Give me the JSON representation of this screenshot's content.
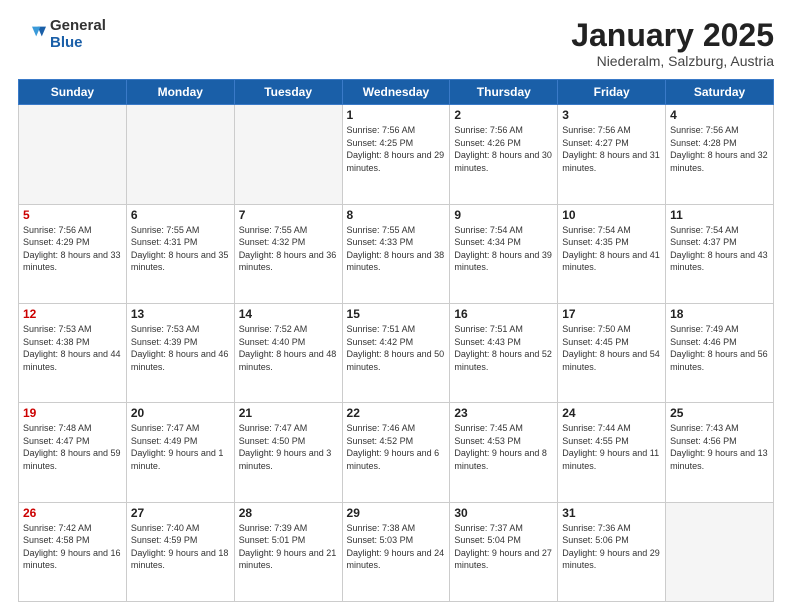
{
  "logo": {
    "general": "General",
    "blue": "Blue"
  },
  "header": {
    "month": "January 2025",
    "location": "Niederalm, Salzburg, Austria"
  },
  "weekdays": [
    "Sunday",
    "Monday",
    "Tuesday",
    "Wednesday",
    "Thursday",
    "Friday",
    "Saturday"
  ],
  "weeks": [
    [
      {
        "day": "",
        "info": ""
      },
      {
        "day": "",
        "info": ""
      },
      {
        "day": "",
        "info": ""
      },
      {
        "day": "1",
        "info": "Sunrise: 7:56 AM\nSunset: 4:25 PM\nDaylight: 8 hours\nand 29 minutes."
      },
      {
        "day": "2",
        "info": "Sunrise: 7:56 AM\nSunset: 4:26 PM\nDaylight: 8 hours\nand 30 minutes."
      },
      {
        "day": "3",
        "info": "Sunrise: 7:56 AM\nSunset: 4:27 PM\nDaylight: 8 hours\nand 31 minutes."
      },
      {
        "day": "4",
        "info": "Sunrise: 7:56 AM\nSunset: 4:28 PM\nDaylight: 8 hours\nand 32 minutes."
      }
    ],
    [
      {
        "day": "5",
        "info": "Sunrise: 7:56 AM\nSunset: 4:29 PM\nDaylight: 8 hours\nand 33 minutes."
      },
      {
        "day": "6",
        "info": "Sunrise: 7:55 AM\nSunset: 4:31 PM\nDaylight: 8 hours\nand 35 minutes."
      },
      {
        "day": "7",
        "info": "Sunrise: 7:55 AM\nSunset: 4:32 PM\nDaylight: 8 hours\nand 36 minutes."
      },
      {
        "day": "8",
        "info": "Sunrise: 7:55 AM\nSunset: 4:33 PM\nDaylight: 8 hours\nand 38 minutes."
      },
      {
        "day": "9",
        "info": "Sunrise: 7:54 AM\nSunset: 4:34 PM\nDaylight: 8 hours\nand 39 minutes."
      },
      {
        "day": "10",
        "info": "Sunrise: 7:54 AM\nSunset: 4:35 PM\nDaylight: 8 hours\nand 41 minutes."
      },
      {
        "day": "11",
        "info": "Sunrise: 7:54 AM\nSunset: 4:37 PM\nDaylight: 8 hours\nand 43 minutes."
      }
    ],
    [
      {
        "day": "12",
        "info": "Sunrise: 7:53 AM\nSunset: 4:38 PM\nDaylight: 8 hours\nand 44 minutes."
      },
      {
        "day": "13",
        "info": "Sunrise: 7:53 AM\nSunset: 4:39 PM\nDaylight: 8 hours\nand 46 minutes."
      },
      {
        "day": "14",
        "info": "Sunrise: 7:52 AM\nSunset: 4:40 PM\nDaylight: 8 hours\nand 48 minutes."
      },
      {
        "day": "15",
        "info": "Sunrise: 7:51 AM\nSunset: 4:42 PM\nDaylight: 8 hours\nand 50 minutes."
      },
      {
        "day": "16",
        "info": "Sunrise: 7:51 AM\nSunset: 4:43 PM\nDaylight: 8 hours\nand 52 minutes."
      },
      {
        "day": "17",
        "info": "Sunrise: 7:50 AM\nSunset: 4:45 PM\nDaylight: 8 hours\nand 54 minutes."
      },
      {
        "day": "18",
        "info": "Sunrise: 7:49 AM\nSunset: 4:46 PM\nDaylight: 8 hours\nand 56 minutes."
      }
    ],
    [
      {
        "day": "19",
        "info": "Sunrise: 7:48 AM\nSunset: 4:47 PM\nDaylight: 8 hours\nand 59 minutes."
      },
      {
        "day": "20",
        "info": "Sunrise: 7:47 AM\nSunset: 4:49 PM\nDaylight: 9 hours\nand 1 minute."
      },
      {
        "day": "21",
        "info": "Sunrise: 7:47 AM\nSunset: 4:50 PM\nDaylight: 9 hours\nand 3 minutes."
      },
      {
        "day": "22",
        "info": "Sunrise: 7:46 AM\nSunset: 4:52 PM\nDaylight: 9 hours\nand 6 minutes."
      },
      {
        "day": "23",
        "info": "Sunrise: 7:45 AM\nSunset: 4:53 PM\nDaylight: 9 hours\nand 8 minutes."
      },
      {
        "day": "24",
        "info": "Sunrise: 7:44 AM\nSunset: 4:55 PM\nDaylight: 9 hours\nand 11 minutes."
      },
      {
        "day": "25",
        "info": "Sunrise: 7:43 AM\nSunset: 4:56 PM\nDaylight: 9 hours\nand 13 minutes."
      }
    ],
    [
      {
        "day": "26",
        "info": "Sunrise: 7:42 AM\nSunset: 4:58 PM\nDaylight: 9 hours\nand 16 minutes."
      },
      {
        "day": "27",
        "info": "Sunrise: 7:40 AM\nSunset: 4:59 PM\nDaylight: 9 hours\nand 18 minutes."
      },
      {
        "day": "28",
        "info": "Sunrise: 7:39 AM\nSunset: 5:01 PM\nDaylight: 9 hours\nand 21 minutes."
      },
      {
        "day": "29",
        "info": "Sunrise: 7:38 AM\nSunset: 5:03 PM\nDaylight: 9 hours\nand 24 minutes."
      },
      {
        "day": "30",
        "info": "Sunrise: 7:37 AM\nSunset: 5:04 PM\nDaylight: 9 hours\nand 27 minutes."
      },
      {
        "day": "31",
        "info": "Sunrise: 7:36 AM\nSunset: 5:06 PM\nDaylight: 9 hours\nand 29 minutes."
      },
      {
        "day": "",
        "info": ""
      }
    ]
  ]
}
